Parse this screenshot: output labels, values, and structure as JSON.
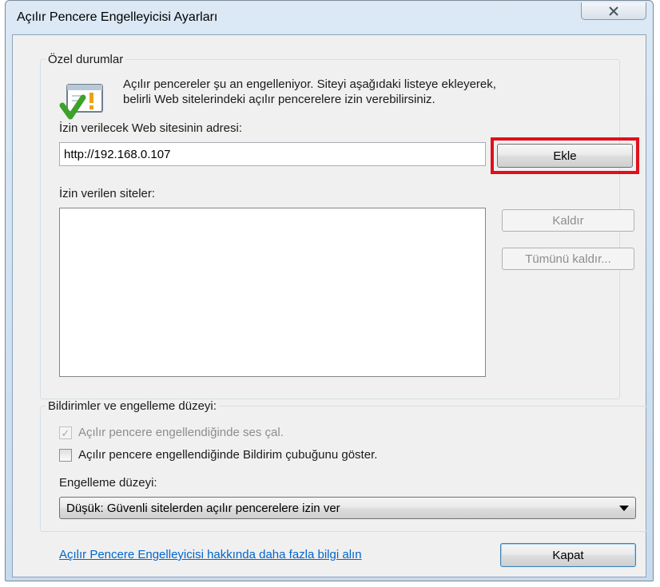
{
  "window": {
    "title": "Açılır Pencere Engelleyicisi Ayarları",
    "close_icon": "close-x-icon"
  },
  "exceptions": {
    "legend": "Özel durumlar",
    "icon": "warning-shield-check-icon",
    "info_line1": "Açılır pencereler şu an engelleniyor. Siteyi aşağıdaki listeye ekleyerek,",
    "info_line2": "belirli Web sitelerindeki açılır pencerelere izin verebilirsiniz.",
    "address_label": "İzin verilecek Web sitesinin adresi:",
    "address_value": "http://192.168.0.107",
    "add_button": "Ekle",
    "allowed_label": "İzin verilen siteler:",
    "allowed_sites": [],
    "remove_button": "Kaldır",
    "remove_all_button": "Tümünü kaldır...",
    "highlight_color": "#e0101a"
  },
  "notifications": {
    "legend": "Bildirimler ve engelleme düzeyi:",
    "play_sound": {
      "label": "Açılır pencere engellendiğinde ses çal.",
      "checked": true,
      "enabled": false
    },
    "show_bar": {
      "label": "Açılır pencere engellendiğinde Bildirim çubuğunu göster.",
      "checked": false,
      "enabled": true
    },
    "level_label": "Engelleme düzeyi:",
    "level_value": "Düşük: Güvenli sitelerden açılır pencerelere izin ver"
  },
  "footer": {
    "help_link": "Açılır Pencere Engelleyicisi hakkında daha fazla bilgi alın",
    "close_button": "Kapat",
    "link_color": "#0066cc"
  }
}
